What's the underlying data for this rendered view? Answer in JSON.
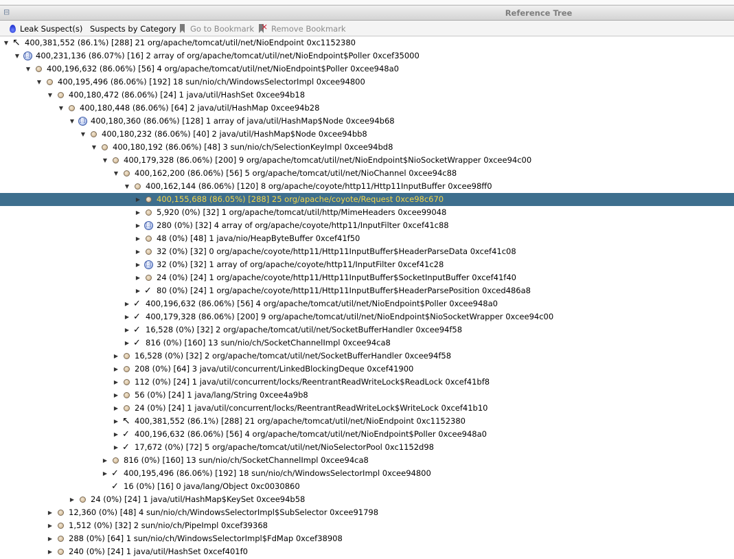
{
  "window": {
    "title": "Reference Tree",
    "icon": "tree-view-icon"
  },
  "toolbar": {
    "leak_suspects_label": "Leak Suspect(s)",
    "leak_suspects_icon": "drop-icon",
    "suspects_by_category_label": "Suspects by Category",
    "goto_bookmark_label": "Go to Bookmark",
    "goto_bookmark_icon": "bookmark-icon",
    "remove_bookmark_label": "Remove Bookmark",
    "remove_bookmark_icon": "remove-bookmark-icon"
  },
  "tree": {
    "selection_color": "#3e6f8e",
    "selected_text_color": "#f2d54a",
    "rows": [
      {
        "depth": 0,
        "toggle": "open",
        "icon": "back-arrow",
        "text": "400,381,552 (86.1%) [288] 21 org/apache/tomcat/util/net/NioEndpoint 0xc1152380"
      },
      {
        "depth": 1,
        "toggle": "open",
        "icon": "array",
        "text": "400,231,136 (86.07%) [16] 2 array of org/apache/tomcat/util/net/NioEndpoint$Poller 0xcef35000"
      },
      {
        "depth": 2,
        "toggle": "open",
        "icon": "object",
        "text": "400,196,632 (86.06%) [56] 4 org/apache/tomcat/util/net/NioEndpoint$Poller 0xcee948a0"
      },
      {
        "depth": 3,
        "toggle": "open",
        "icon": "object",
        "text": "400,195,496 (86.06%) [192] 18 sun/nio/ch/WindowsSelectorImpl 0xcee94800"
      },
      {
        "depth": 4,
        "toggle": "open",
        "icon": "object",
        "text": "400,180,472 (86.06%) [24] 1 java/util/HashSet 0xcee94b18"
      },
      {
        "depth": 5,
        "toggle": "open",
        "icon": "object",
        "text": "400,180,448 (86.06%) [64] 2 java/util/HashMap 0xcee94b28"
      },
      {
        "depth": 6,
        "toggle": "open",
        "icon": "array",
        "text": "400,180,360 (86.06%) [128] 1 array of java/util/HashMap$Node 0xcee94b68"
      },
      {
        "depth": 7,
        "toggle": "open",
        "icon": "object",
        "text": "400,180,232 (86.06%) [40] 2 java/util/HashMap$Node 0xcee94bb8"
      },
      {
        "depth": 8,
        "toggle": "open",
        "icon": "object",
        "text": "400,180,192 (86.06%) [48] 3 sun/nio/ch/SelectionKeyImpl 0xcee94bd8"
      },
      {
        "depth": 9,
        "toggle": "open",
        "icon": "object",
        "text": "400,179,328 (86.06%) [200] 9 org/apache/tomcat/util/net/NioEndpoint$NioSocketWrapper 0xcee94c00"
      },
      {
        "depth": 10,
        "toggle": "open",
        "icon": "object",
        "text": "400,162,200 (86.06%) [56] 5 org/apache/tomcat/util/net/NioChannel 0xcee94c88"
      },
      {
        "depth": 11,
        "toggle": "open",
        "icon": "object",
        "text": "400,162,144 (86.06%) [120] 8 org/apache/coyote/http11/Http11InputBuffer 0xcee98ff0"
      },
      {
        "depth": 12,
        "toggle": "closed",
        "icon": "object",
        "text": "400,155,688 (86.05%) [288] 25 org/apache/coyote/Request 0xce98c670",
        "selected": true
      },
      {
        "depth": 12,
        "toggle": "closed",
        "icon": "object",
        "text": "5,920 (0%) [32] 1 org/apache/tomcat/util/http/MimeHeaders 0xcee99048"
      },
      {
        "depth": 12,
        "toggle": "closed",
        "icon": "array",
        "text": "280 (0%) [32] 4 array of org/apache/coyote/http11/InputFilter 0xcef41c88"
      },
      {
        "depth": 12,
        "toggle": "closed",
        "icon": "object",
        "text": "48 (0%) [48] 1 java/nio/HeapByteBuffer 0xcef41f50"
      },
      {
        "depth": 12,
        "toggle": "closed",
        "icon": "object",
        "text": "32 (0%) [32] 0 org/apache/coyote/http11/Http11InputBuffer$HeaderParseData 0xcef41c08"
      },
      {
        "depth": 12,
        "toggle": "closed",
        "icon": "array",
        "text": "32 (0%) [32] 1 array of org/apache/coyote/http11/InputFilter 0xcef41c28"
      },
      {
        "depth": 12,
        "toggle": "closed",
        "icon": "object",
        "text": "24 (0%) [24] 1 org/apache/coyote/http11/Http11InputBuffer$SocketInputBuffer 0xcef41f40"
      },
      {
        "depth": 12,
        "toggle": "closed",
        "icon": "check",
        "text": "80 (0%) [24] 1 org/apache/coyote/http11/Http11InputBuffer$HeaderParsePosition 0xced486a8"
      },
      {
        "depth": 11,
        "toggle": "closed",
        "icon": "check",
        "text": "400,196,632 (86.06%) [56] 4 org/apache/tomcat/util/net/NioEndpoint$Poller 0xcee948a0"
      },
      {
        "depth": 11,
        "toggle": "closed",
        "icon": "check",
        "text": "400,179,328 (86.06%) [200] 9 org/apache/tomcat/util/net/NioEndpoint$NioSocketWrapper 0xcee94c00"
      },
      {
        "depth": 11,
        "toggle": "closed",
        "icon": "check",
        "text": "16,528 (0%) [32] 2 org/apache/tomcat/util/net/SocketBufferHandler 0xcee94f58"
      },
      {
        "depth": 11,
        "toggle": "closed",
        "icon": "check",
        "text": "816 (0%) [160] 13 sun/nio/ch/SocketChannelImpl 0xcee94ca8"
      },
      {
        "depth": 10,
        "toggle": "closed",
        "icon": "object",
        "text": "16,528 (0%) [32] 2 org/apache/tomcat/util/net/SocketBufferHandler 0xcee94f58"
      },
      {
        "depth": 10,
        "toggle": "closed",
        "icon": "object",
        "text": "208 (0%) [64] 3 java/util/concurrent/LinkedBlockingDeque 0xcef41900"
      },
      {
        "depth": 10,
        "toggle": "closed",
        "icon": "object",
        "text": "112 (0%) [24] 1 java/util/concurrent/locks/ReentrantReadWriteLock$ReadLock 0xcef41bf8"
      },
      {
        "depth": 10,
        "toggle": "closed",
        "icon": "object",
        "text": "56 (0%) [24] 1 java/lang/String 0xcee4a9b8"
      },
      {
        "depth": 10,
        "toggle": "closed",
        "icon": "object",
        "text": "24 (0%) [24] 1 java/util/concurrent/locks/ReentrantReadWriteLock$WriteLock 0xcef41b10"
      },
      {
        "depth": 10,
        "toggle": "closed",
        "icon": "back-arrow",
        "text": "400,381,552 (86.1%) [288] 21 org/apache/tomcat/util/net/NioEndpoint 0xc1152380"
      },
      {
        "depth": 10,
        "toggle": "closed",
        "icon": "check",
        "text": "400,196,632 (86.06%) [56] 4 org/apache/tomcat/util/net/NioEndpoint$Poller 0xcee948a0"
      },
      {
        "depth": 10,
        "toggle": "closed",
        "icon": "check",
        "text": "17,672 (0%) [72] 5 org/apache/tomcat/util/net/NioSelectorPool 0xc1152d98"
      },
      {
        "depth": 9,
        "toggle": "closed",
        "icon": "object",
        "text": "816 (0%) [160] 13 sun/nio/ch/SocketChannelImpl 0xcee94ca8"
      },
      {
        "depth": 9,
        "toggle": "closed",
        "icon": "check",
        "text": "400,195,496 (86.06%) [192] 18 sun/nio/ch/WindowsSelectorImpl 0xcee94800"
      },
      {
        "depth": 9,
        "toggle": "none",
        "icon": "check",
        "text": "16 (0%) [16] 0 java/lang/Object 0xc0030860"
      },
      {
        "depth": 6,
        "toggle": "closed",
        "icon": "object",
        "text": "24 (0%) [24] 1 java/util/HashMap$KeySet 0xcee94b58"
      },
      {
        "depth": 4,
        "toggle": "closed",
        "icon": "object",
        "text": "12,360 (0%) [48] 4 sun/nio/ch/WindowsSelectorImpl$SubSelector 0xcee91798"
      },
      {
        "depth": 4,
        "toggle": "closed",
        "icon": "object",
        "text": "1,512 (0%) [32] 2 sun/nio/ch/PipeImpl 0xcef39368"
      },
      {
        "depth": 4,
        "toggle": "closed",
        "icon": "object",
        "text": "288 (0%) [64] 1 sun/nio/ch/WindowsSelectorImpl$FdMap 0xcef38908"
      },
      {
        "depth": 4,
        "toggle": "closed",
        "icon": "object",
        "text": "240 (0%) [24] 1 java/util/HashSet 0xcef401f0"
      }
    ]
  }
}
